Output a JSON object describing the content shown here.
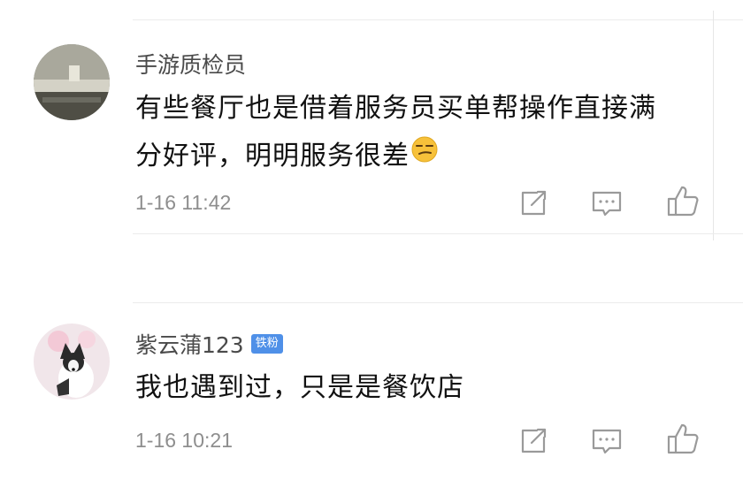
{
  "comments": [
    {
      "username": "手游质检员",
      "badge": "",
      "text_line1": "有些餐厅也是借着服务员买单帮操作直接满",
      "text_line2": "分好评，明明服务很差",
      "emoji": "smirk-face",
      "timestamp": "1-16 11:42"
    },
    {
      "username": "紫云蒲123",
      "badge": "铁粉",
      "text_line1": "我也遇到过，只是是餐饮店",
      "timestamp": "1-16 10:21"
    }
  ],
  "actions": [
    "share-icon",
    "comment-icon",
    "like-icon"
  ],
  "colors": {
    "badge": "#4f90e8",
    "text": "#111111",
    "username": "#4a4a4a",
    "timestamp": "#8e8e8e",
    "icon": "#9a9a9a"
  }
}
